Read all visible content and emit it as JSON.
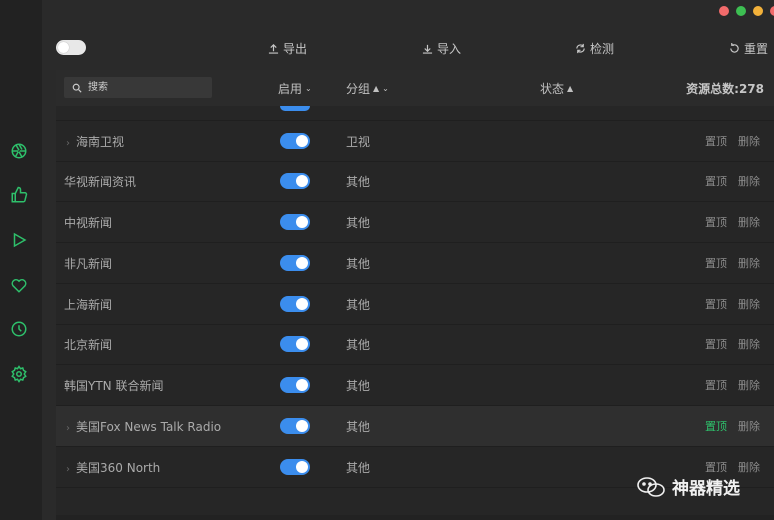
{
  "window_controls": [
    "#f26b6b",
    "#3dbf52",
    "#f2b13a",
    "#f26b6b"
  ],
  "toolbar": {
    "export_label": "导出",
    "import_label": "导入",
    "check_label": "检测",
    "reset_label": "重置"
  },
  "table": {
    "search_placeholder": "搜索",
    "headers": {
      "enabled": "启用",
      "group": "分组",
      "status": "状态",
      "total": "资源总数:278"
    },
    "rows": [
      {
        "name": "海南卫视",
        "group": "卫视",
        "pin": "置顶",
        "delete": "删除",
        "expandable": true
      },
      {
        "name": "华视新闻资讯",
        "group": "其他",
        "pin": "置顶",
        "delete": "删除",
        "expandable": false
      },
      {
        "name": "中视新闻",
        "group": "其他",
        "pin": "置顶",
        "delete": "删除",
        "expandable": false
      },
      {
        "name": "非凡新闻",
        "group": "其他",
        "pin": "置顶",
        "delete": "删除",
        "expandable": false
      },
      {
        "name": "上海新闻",
        "group": "其他",
        "pin": "置顶",
        "delete": "删除",
        "expandable": false
      },
      {
        "name": "北京新闻",
        "group": "其他",
        "pin": "置顶",
        "delete": "删除",
        "expandable": false
      },
      {
        "name": "韩国YTN 联合新闻",
        "group": "其他",
        "pin": "置顶",
        "delete": "删除",
        "expandable": false
      },
      {
        "name": "美国Fox News Talk Radio",
        "group": "其他",
        "pin": "置顶",
        "delete": "删除",
        "expandable": true
      },
      {
        "name": "美国360 North",
        "group": "其他",
        "pin": "置顶",
        "delete": "删除",
        "expandable": true
      }
    ]
  },
  "watermark": "神器精选",
  "sidebar_icons": [
    "aperture-icon",
    "thumbs-up-icon",
    "play-icon",
    "heart-icon",
    "clock-icon",
    "settings-icon"
  ],
  "accent": "#3b8ded",
  "sidebar_icon_color": "#2ec06b"
}
